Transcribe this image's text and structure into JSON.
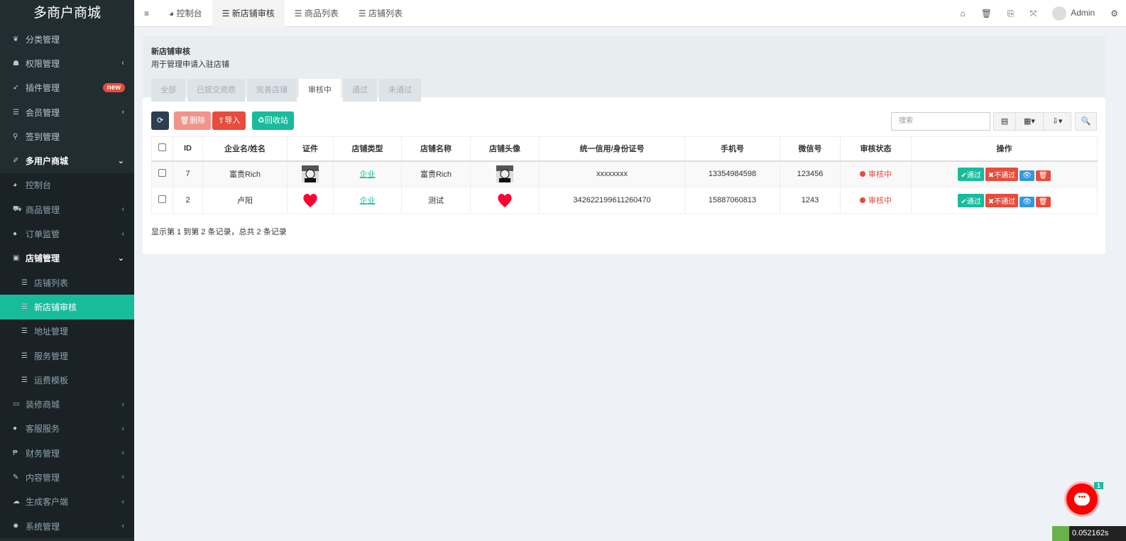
{
  "app_title": "多商户商城",
  "sidebar": {
    "items": [
      {
        "label": "分类管理",
        "icon": "leaf-icon",
        "arrow": ""
      },
      {
        "label": "权限管理",
        "icon": "group-icon",
        "arrow": "‹"
      },
      {
        "label": "插件管理",
        "icon": "rocket-icon",
        "arrow": "",
        "badge": "new"
      },
      {
        "label": "会员管理",
        "icon": "list-icon",
        "arrow": "‹"
      },
      {
        "label": "签到管理",
        "icon": "map-marker-icon",
        "arrow": ""
      },
      {
        "label": "多用户商城",
        "icon": "magic-icon",
        "arrow": "⌄"
      }
    ],
    "sub": [
      {
        "label": "控制台",
        "icon": "dashboard-icon",
        "arrow": ""
      },
      {
        "label": "商品管理",
        "icon": "cart-icon",
        "arrow": "‹"
      },
      {
        "label": "订单监管",
        "icon": "globe-icon",
        "arrow": "‹"
      },
      {
        "label": "店铺管理",
        "icon": "store-icon",
        "arrow": "⌄"
      },
      {
        "label": "店铺列表",
        "icon": "list-icon"
      },
      {
        "label": "新店铺审核",
        "icon": "list-icon"
      },
      {
        "label": "地址管理",
        "icon": "list-icon"
      },
      {
        "label": "服务管理",
        "icon": "list-icon"
      },
      {
        "label": "运费模板",
        "icon": "list-icon"
      }
    ],
    "bottom": [
      {
        "label": "装修商城",
        "icon": "desktop-icon",
        "arrow": "‹"
      },
      {
        "label": "客服服务",
        "icon": "comments-icon",
        "arrow": "‹"
      },
      {
        "label": "财务管理",
        "icon": "paypal-icon",
        "arrow": "‹"
      },
      {
        "label": "内容管理",
        "icon": "edit-icon",
        "arrow": "‹"
      },
      {
        "label": "生成客户端",
        "icon": "cloud-icon",
        "arrow": "‹"
      },
      {
        "label": "系统管理",
        "icon": "cog-icon",
        "arrow": "‹"
      }
    ]
  },
  "topbar": {
    "tabs": [
      "控制台",
      "新店铺审核",
      "商品列表",
      "店铺列表"
    ],
    "user": "Admin"
  },
  "panel": {
    "title": "新店铺审核",
    "desc": "用于管理申请入驻店铺",
    "tabs": [
      "全部",
      "已提交资质",
      "完善店铺",
      "审核中",
      "通过",
      "未通过"
    ]
  },
  "toolbar": {
    "delete": "删除",
    "import": "导入",
    "recycle": "回收站",
    "search_placeholder": "搜索"
  },
  "table": {
    "headers": [
      "ID",
      "企业名/姓名",
      "证件",
      "店铺类型",
      "店铺名称",
      "店铺头像",
      "统一信用/身份证号",
      "手机号",
      "微信号",
      "审核状态",
      "操作"
    ],
    "rows": [
      {
        "id": "7",
        "name": "富贵Rich",
        "type": "企业",
        "shop": "富贵Rich",
        "credit": "xxxxxxxx",
        "phone": "13354984598",
        "wechat": "123456",
        "status": "审核中",
        "img": "portrait"
      },
      {
        "id": "2",
        "name": "卢阳",
        "type": "企业",
        "shop": "测试",
        "credit": "342622199611260470",
        "phone": "15887060813",
        "wechat": "1243",
        "status": "审核中",
        "img": "heart"
      }
    ],
    "actions": {
      "pass": "通过",
      "reject": "不通过"
    }
  },
  "footer": "显示第 1 到第 2 条记录，总共 2 条记录",
  "chat_count": "1",
  "timer": "0.052162s",
  "colors": {
    "accent": "#18bc9c",
    "danger": "#e74c3c",
    "sidebar": "#222d32"
  }
}
